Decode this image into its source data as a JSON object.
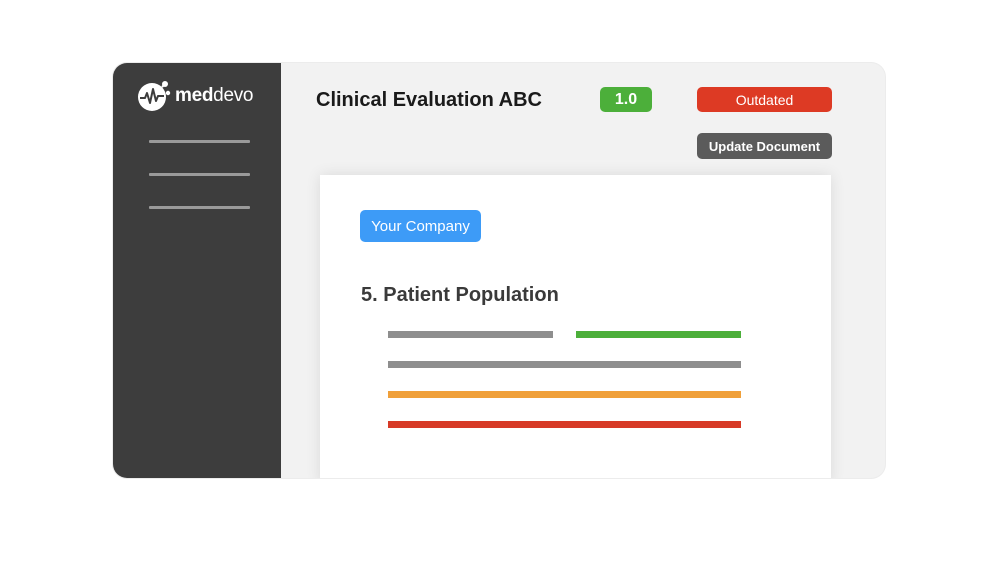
{
  "sidebar": {
    "logo": {
      "text_bold": "med",
      "text_regular": "devo",
      "icon": "heartbeat-molecule-icon"
    },
    "nav_items": [
      "",
      "",
      ""
    ]
  },
  "header": {
    "title": "Clinical Evaluation ABC",
    "version": "1.0",
    "status": "Outdated",
    "update_button_label": "Update Document"
  },
  "document": {
    "company_chip": "Your Company",
    "section_heading": "5. Patient Population"
  },
  "colors": {
    "sidebar": "#3d3d3d",
    "version_green": "#4caf3a",
    "status_red": "#dd3a24",
    "button_gray": "#5b5b5b",
    "chip_blue": "#3d9bf7",
    "line_gray": "#8e8e8e",
    "line_green": "#4caf3a",
    "line_orange": "#f0a03a",
    "line_red": "#d73a27"
  }
}
